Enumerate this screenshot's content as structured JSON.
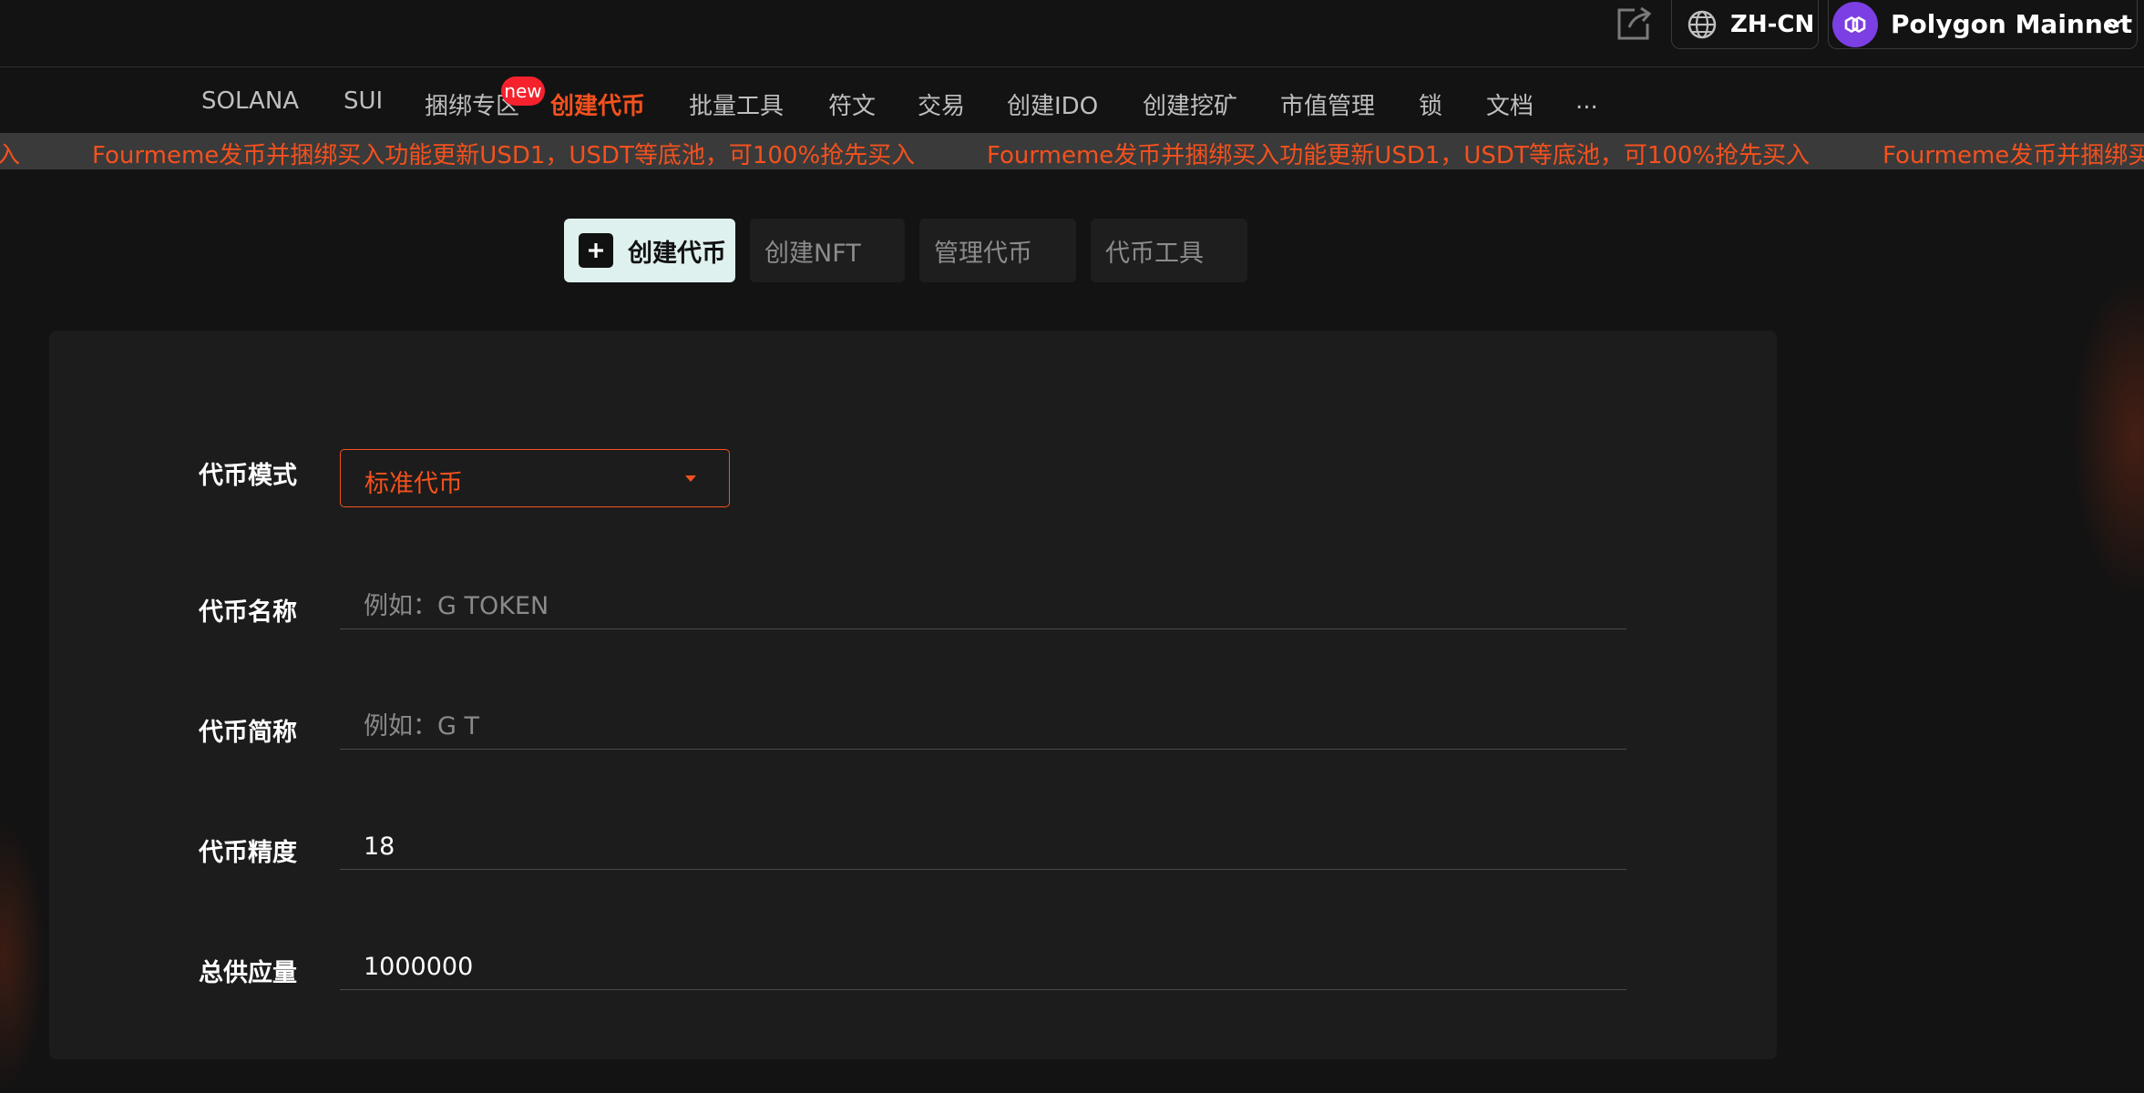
{
  "header": {
    "language": "ZH-CN",
    "network": "Polygon Mainnet",
    "icons": {
      "share": "share-icon",
      "language": "globe-icon",
      "network": "polygon-logo",
      "dropdown": "chevron-down-icon"
    }
  },
  "nav": {
    "items": [
      {
        "label": "SOLANA"
      },
      {
        "label": "SUI"
      },
      {
        "label": "捆绑专区"
      },
      {
        "label": "创建代币"
      },
      {
        "label": "批量工具"
      },
      {
        "label": "符文"
      },
      {
        "label": "交易"
      },
      {
        "label": "创建IDO"
      },
      {
        "label": "创建挖矿"
      },
      {
        "label": "市值管理"
      },
      {
        "label": "锁"
      },
      {
        "label": "文档"
      },
      {
        "label": "..."
      }
    ],
    "new_badge": "new",
    "active_color": "#f4511e"
  },
  "announcement": {
    "text": "Fourmeme发币并捆绑买入功能更新USD1，USDT等底池，可100%抢先买入",
    "leading_fragment": "入",
    "trailing_fragment": "Fourmeme发币并捆绑买"
  },
  "tabs": [
    {
      "label": "创建代币"
    },
    {
      "label": "创建NFT"
    },
    {
      "label": "管理代币"
    },
    {
      "label": "代币工具"
    }
  ],
  "form": {
    "mode": {
      "label": "代币模式",
      "value": "标准代币"
    },
    "name": {
      "label": "代币名称",
      "value": "",
      "placeholder": "例如：G TOKEN"
    },
    "symbol": {
      "label": "代币简称",
      "value": "",
      "placeholder": "例如：G T"
    },
    "decimals": {
      "label": "代币精度",
      "value": "18",
      "placeholder": ""
    },
    "supply": {
      "label": "总供应量",
      "value": "1000000",
      "placeholder": ""
    }
  }
}
